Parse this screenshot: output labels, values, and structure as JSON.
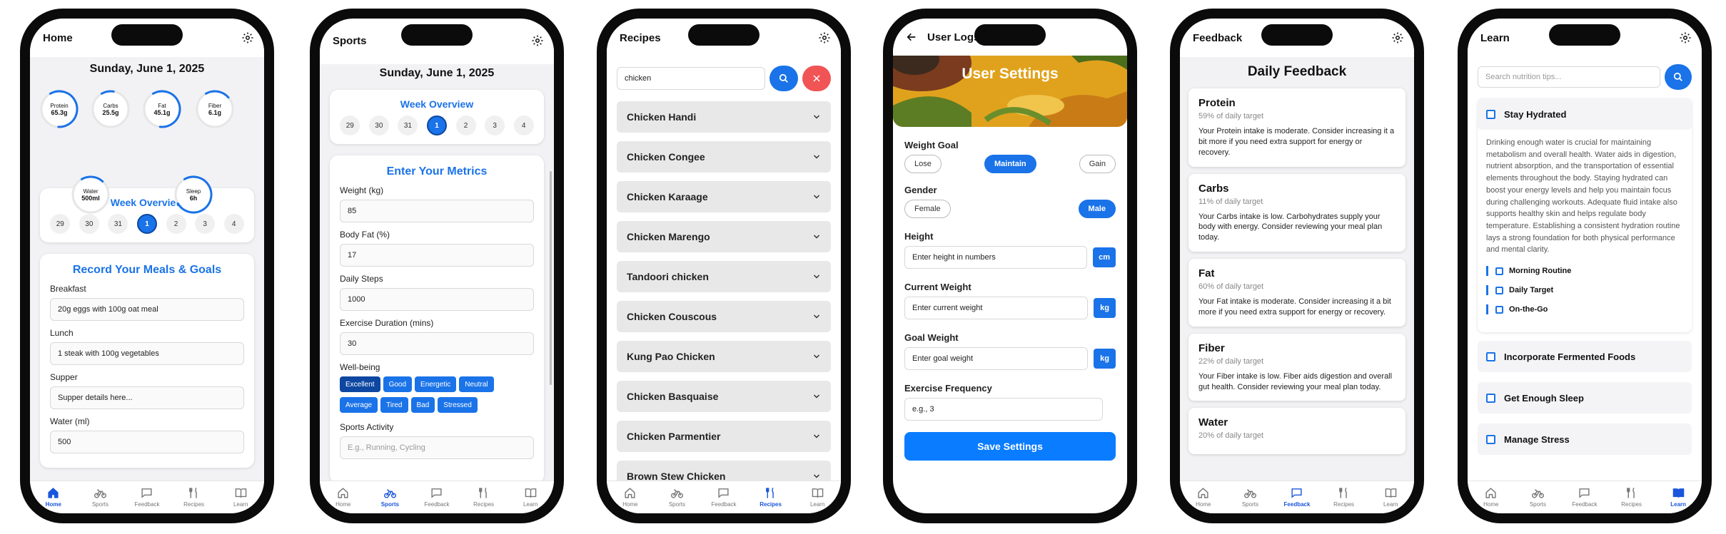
{
  "nav": [
    {
      "label": "Home",
      "icon": "home-icon"
    },
    {
      "label": "Sports",
      "icon": "bike-icon"
    },
    {
      "label": "Feedback",
      "icon": "chat-icon"
    },
    {
      "label": "Recipes",
      "icon": "utensils-icon"
    },
    {
      "label": "Learn",
      "icon": "book-icon"
    }
  ],
  "colors": {
    "accent": "#1a73e8",
    "accent_dark": "#0d47a1",
    "danger": "#f05454"
  },
  "week": {
    "title": "Week Overview",
    "days": [
      "29",
      "30",
      "31",
      "1",
      "2",
      "3",
      "4"
    ],
    "selected": "1"
  },
  "home": {
    "title": "Home",
    "date": "Sunday, June 1, 2025",
    "rings": [
      {
        "label": "Protein",
        "value": "65.3g",
        "progress": 0.59
      },
      {
        "label": "Carbs",
        "value": "25.5g",
        "progress": 0.11
      },
      {
        "label": "Fat",
        "value": "45.1g",
        "progress": 0.6
      },
      {
        "label": "Fiber",
        "value": "6.1g",
        "progress": 0.22
      },
      {
        "label": "Water",
        "value": "500ml",
        "progress": 0.2
      },
      {
        "label": "Sleep",
        "value": "6h",
        "progress": 0.75
      }
    ],
    "meals_title": "Record Your Meals & Goals",
    "fields": [
      {
        "label": "Breakfast",
        "value": "20g eggs with 100g oat meal"
      },
      {
        "label": "Lunch",
        "value": "1 steak with 100g vegetables"
      },
      {
        "label": "Supper",
        "value": "Supper details here..."
      },
      {
        "label": "Water (ml)",
        "value": "500"
      }
    ]
  },
  "sports": {
    "title": "Sports",
    "date": "Sunday, June 1, 2025",
    "metrics_title": "Enter Your Metrics",
    "fields": [
      {
        "label": "Weight (kg)",
        "value": "85"
      },
      {
        "label": "Body Fat (%)",
        "value": "17"
      },
      {
        "label": "Daily Steps",
        "value": "1000"
      },
      {
        "label": "Exercise Duration (mins)",
        "value": "30"
      }
    ],
    "wellbeing_label": "Well-being",
    "wellbeing_options": [
      "Excellent",
      "Good",
      "Energetic",
      "Neutral",
      "Average",
      "Tired",
      "Bad",
      "Stressed"
    ],
    "wellbeing_selected": "Excellent",
    "activity_label": "Sports Activity",
    "activity_placeholder": "E.g., Running, Cycling"
  },
  "recipes": {
    "title": "Recipes",
    "search_value": "chicken",
    "items": [
      "Chicken Handi",
      "Chicken Congee",
      "Chicken Karaage",
      "Chicken Marengo",
      "Tandoori chicken",
      "Chicken Couscous",
      "Kung Pao Chicken",
      "Chicken Basquaise",
      "Chicken Parmentier",
      "Brown Stew Chicken"
    ]
  },
  "settings": {
    "header": "User Logs",
    "banner_title": "User Settings",
    "weight_goal_label": "Weight Goal",
    "weight_goal_options": [
      "Lose",
      "Maintain",
      "Gain"
    ],
    "weight_goal_selected": "Maintain",
    "gender_label": "Gender",
    "gender_options": [
      "Female",
      "Male"
    ],
    "gender_selected": "Male",
    "height_label": "Height",
    "height_placeholder": "Enter height in numbers",
    "height_unit": "cm",
    "current_weight_label": "Current Weight",
    "current_weight_placeholder": "Enter current weight",
    "current_weight_unit": "kg",
    "goal_weight_label": "Goal Weight",
    "goal_weight_placeholder": "Enter goal weight",
    "goal_weight_unit": "kg",
    "exercise_label": "Exercise Frequency",
    "exercise_placeholder": "e.g., 3",
    "save_label": "Save Settings"
  },
  "feedback": {
    "title": "Feedback",
    "heading": "Daily Feedback",
    "cards": [
      {
        "name": "Protein",
        "sub": "59% of daily target",
        "text": "Your Protein intake is moderate. Consider increasing it a bit more if you need extra support for energy or recovery."
      },
      {
        "name": "Carbs",
        "sub": "11% of daily target",
        "text": "Your Carbs intake is low. Carbohydrates supply your body with energy. Consider reviewing your meal plan today."
      },
      {
        "name": "Fat",
        "sub": "60% of daily target",
        "text": "Your Fat intake is moderate. Consider increasing it a bit more if you need extra support for energy or recovery."
      },
      {
        "name": "Fiber",
        "sub": "22% of daily target",
        "text": "Your Fiber intake is low. Fiber aids digestion and overall gut health. Consider reviewing your meal plan today."
      },
      {
        "name": "Water",
        "sub": "20% of daily target",
        "text": ""
      }
    ]
  },
  "learn": {
    "title": "Learn",
    "search_placeholder": "Search nutrition tips...",
    "open_tip": "Stay Hydrated",
    "open_text": "Drinking enough water is crucial for maintaining metabolism and overall health. Water aids in digestion, nutrient absorption, and the transportation of essential elements throughout the body. Staying hydrated can boost your energy levels and help you maintain focus during challenging workouts. Adequate fluid intake also supports healthy skin and helps regulate body temperature. Establishing a consistent hydration routine lays a strong foundation for both physical performance and mental clarity.",
    "sub_tips": [
      "Morning Routine",
      "Daily Target",
      "On-the-Go"
    ],
    "other_tips": [
      "Incorporate Fermented Foods",
      "Get Enough Sleep",
      "Manage Stress"
    ]
  }
}
